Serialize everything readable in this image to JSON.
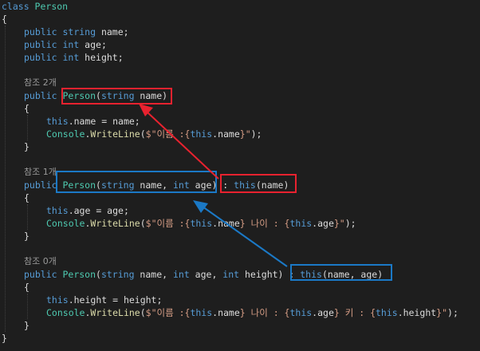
{
  "colors": {
    "background": "#1e1e1e",
    "keyword": "#569cd6",
    "type": "#4ec9b0",
    "method": "#dcdcaa",
    "string": "#d69d85",
    "plain": "#dcdcdc",
    "codelens": "#999999",
    "red_highlight": "#e8222f",
    "blue_highlight": "#1b79c6"
  },
  "lines": [
    {
      "indent": 0,
      "tokens": [
        [
          "class ",
          "keyword"
        ],
        [
          "Person",
          "type"
        ]
      ]
    },
    {
      "indent": 0,
      "tokens": [
        [
          "{",
          "plain"
        ]
      ]
    },
    {
      "indent": 1,
      "tokens": [
        [
          "public ",
          "keyword"
        ],
        [
          "string ",
          "keyword"
        ],
        [
          "name;",
          "plain"
        ]
      ]
    },
    {
      "indent": 1,
      "tokens": [
        [
          "public ",
          "keyword"
        ],
        [
          "int ",
          "keyword"
        ],
        [
          "age;",
          "plain"
        ]
      ]
    },
    {
      "indent": 1,
      "tokens": [
        [
          "public ",
          "keyword"
        ],
        [
          "int ",
          "keyword"
        ],
        [
          "height;",
          "plain"
        ]
      ]
    },
    {
      "indent": 0,
      "tokens": []
    },
    {
      "indent": 1,
      "lens": true,
      "tokens": [
        [
          "참조 2개",
          "codelens"
        ]
      ]
    },
    {
      "indent": 1,
      "tokens": [
        [
          "public ",
          "keyword"
        ],
        [
          "Person",
          "type"
        ],
        [
          "(",
          "plain"
        ],
        [
          "string ",
          "keyword"
        ],
        [
          "name)",
          "plain"
        ]
      ]
    },
    {
      "indent": 1,
      "tokens": [
        [
          "{",
          "plain"
        ]
      ]
    },
    {
      "indent": 2,
      "tokens": [
        [
          "this",
          "keyword"
        ],
        [
          ".name = name;",
          "plain"
        ]
      ]
    },
    {
      "indent": 2,
      "tokens": [
        [
          "Console",
          "type"
        ],
        [
          ".",
          "plain"
        ],
        [
          "WriteLine",
          "method"
        ],
        [
          "(",
          "plain"
        ],
        [
          "$\"이름 :{",
          "string"
        ],
        [
          "this",
          "keyword"
        ],
        [
          ".name",
          "plain"
        ],
        [
          "}\"",
          "string"
        ],
        [
          ");",
          "plain"
        ]
      ]
    },
    {
      "indent": 1,
      "tokens": [
        [
          "}",
          "plain"
        ]
      ]
    },
    {
      "indent": 0,
      "tokens": []
    },
    {
      "indent": 1,
      "lens": true,
      "tokens": [
        [
          "참조 1개",
          "codelens"
        ]
      ]
    },
    {
      "indent": 1,
      "tokens": [
        [
          "public ",
          "keyword"
        ],
        [
          "Person",
          "type"
        ],
        [
          "(",
          "plain"
        ],
        [
          "string ",
          "keyword"
        ],
        [
          "name, ",
          "plain"
        ],
        [
          "int ",
          "keyword"
        ],
        [
          "age) : ",
          "plain"
        ],
        [
          "this",
          "keyword"
        ],
        [
          "(name)",
          "plain"
        ]
      ]
    },
    {
      "indent": 1,
      "tokens": [
        [
          "{",
          "plain"
        ]
      ]
    },
    {
      "indent": 2,
      "tokens": [
        [
          "this",
          "keyword"
        ],
        [
          ".age = age;",
          "plain"
        ]
      ]
    },
    {
      "indent": 2,
      "tokens": [
        [
          "Console",
          "type"
        ],
        [
          ".",
          "plain"
        ],
        [
          "WriteLine",
          "method"
        ],
        [
          "(",
          "plain"
        ],
        [
          "$\"이름 :{",
          "string"
        ],
        [
          "this",
          "keyword"
        ],
        [
          ".name",
          "plain"
        ],
        [
          "} 나이 : {",
          "string"
        ],
        [
          "this",
          "keyword"
        ],
        [
          ".age",
          "plain"
        ],
        [
          "}\"",
          "string"
        ],
        [
          ");",
          "plain"
        ]
      ]
    },
    {
      "indent": 1,
      "tokens": [
        [
          "}",
          "plain"
        ]
      ]
    },
    {
      "indent": 0,
      "tokens": []
    },
    {
      "indent": 1,
      "lens": true,
      "tokens": [
        [
          "참조 0개",
          "codelens"
        ]
      ]
    },
    {
      "indent": 1,
      "tokens": [
        [
          "public ",
          "keyword"
        ],
        [
          "Person",
          "type"
        ],
        [
          "(",
          "plain"
        ],
        [
          "string ",
          "keyword"
        ],
        [
          "name, ",
          "plain"
        ],
        [
          "int ",
          "keyword"
        ],
        [
          "age, ",
          "plain"
        ],
        [
          "int ",
          "keyword"
        ],
        [
          "height) : ",
          "plain"
        ],
        [
          "this",
          "keyword"
        ],
        [
          "(name, age)",
          "plain"
        ]
      ]
    },
    {
      "indent": 1,
      "tokens": [
        [
          "{",
          "plain"
        ]
      ]
    },
    {
      "indent": 2,
      "tokens": [
        [
          "this",
          "keyword"
        ],
        [
          ".height = height;",
          "plain"
        ]
      ]
    },
    {
      "indent": 2,
      "tokens": [
        [
          "Console",
          "type"
        ],
        [
          ".",
          "plain"
        ],
        [
          "WriteLine",
          "method"
        ],
        [
          "(",
          "plain"
        ],
        [
          "$\"이름 :{",
          "string"
        ],
        [
          "this",
          "keyword"
        ],
        [
          ".name",
          "plain"
        ],
        [
          "} 나이 : {",
          "string"
        ],
        [
          "this",
          "keyword"
        ],
        [
          ".age",
          "plain"
        ],
        [
          "} 키 : {",
          "string"
        ],
        [
          "this",
          "keyword"
        ],
        [
          ".height",
          "plain"
        ],
        [
          "}\"",
          "string"
        ],
        [
          ");",
          "plain"
        ]
      ]
    },
    {
      "indent": 1,
      "tokens": [
        [
          "}",
          "plain"
        ]
      ]
    },
    {
      "indent": 0,
      "tokens": [
        [
          "}",
          "plain"
        ]
      ]
    }
  ]
}
